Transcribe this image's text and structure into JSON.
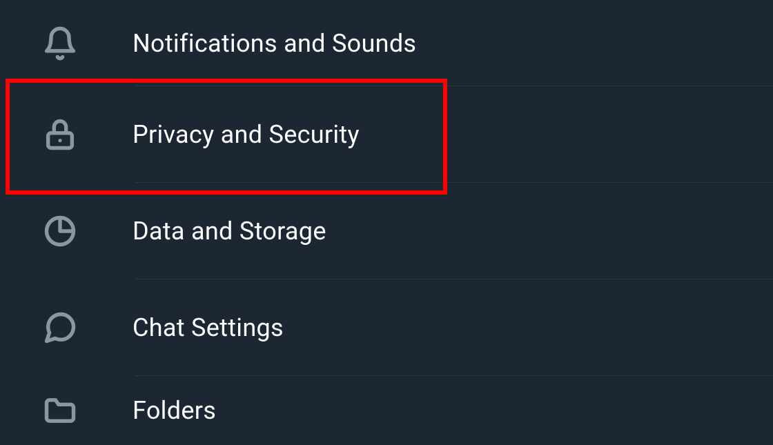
{
  "settings": {
    "items": [
      {
        "label": "Notifications and Sounds",
        "icon": "bell-icon"
      },
      {
        "label": "Privacy and Security",
        "icon": "lock-icon"
      },
      {
        "label": "Data and Storage",
        "icon": "pie-chart-icon"
      },
      {
        "label": "Chat Settings",
        "icon": "chat-icon"
      },
      {
        "label": "Folders",
        "icon": "folder-icon"
      }
    ],
    "highlighted_index": 1
  }
}
